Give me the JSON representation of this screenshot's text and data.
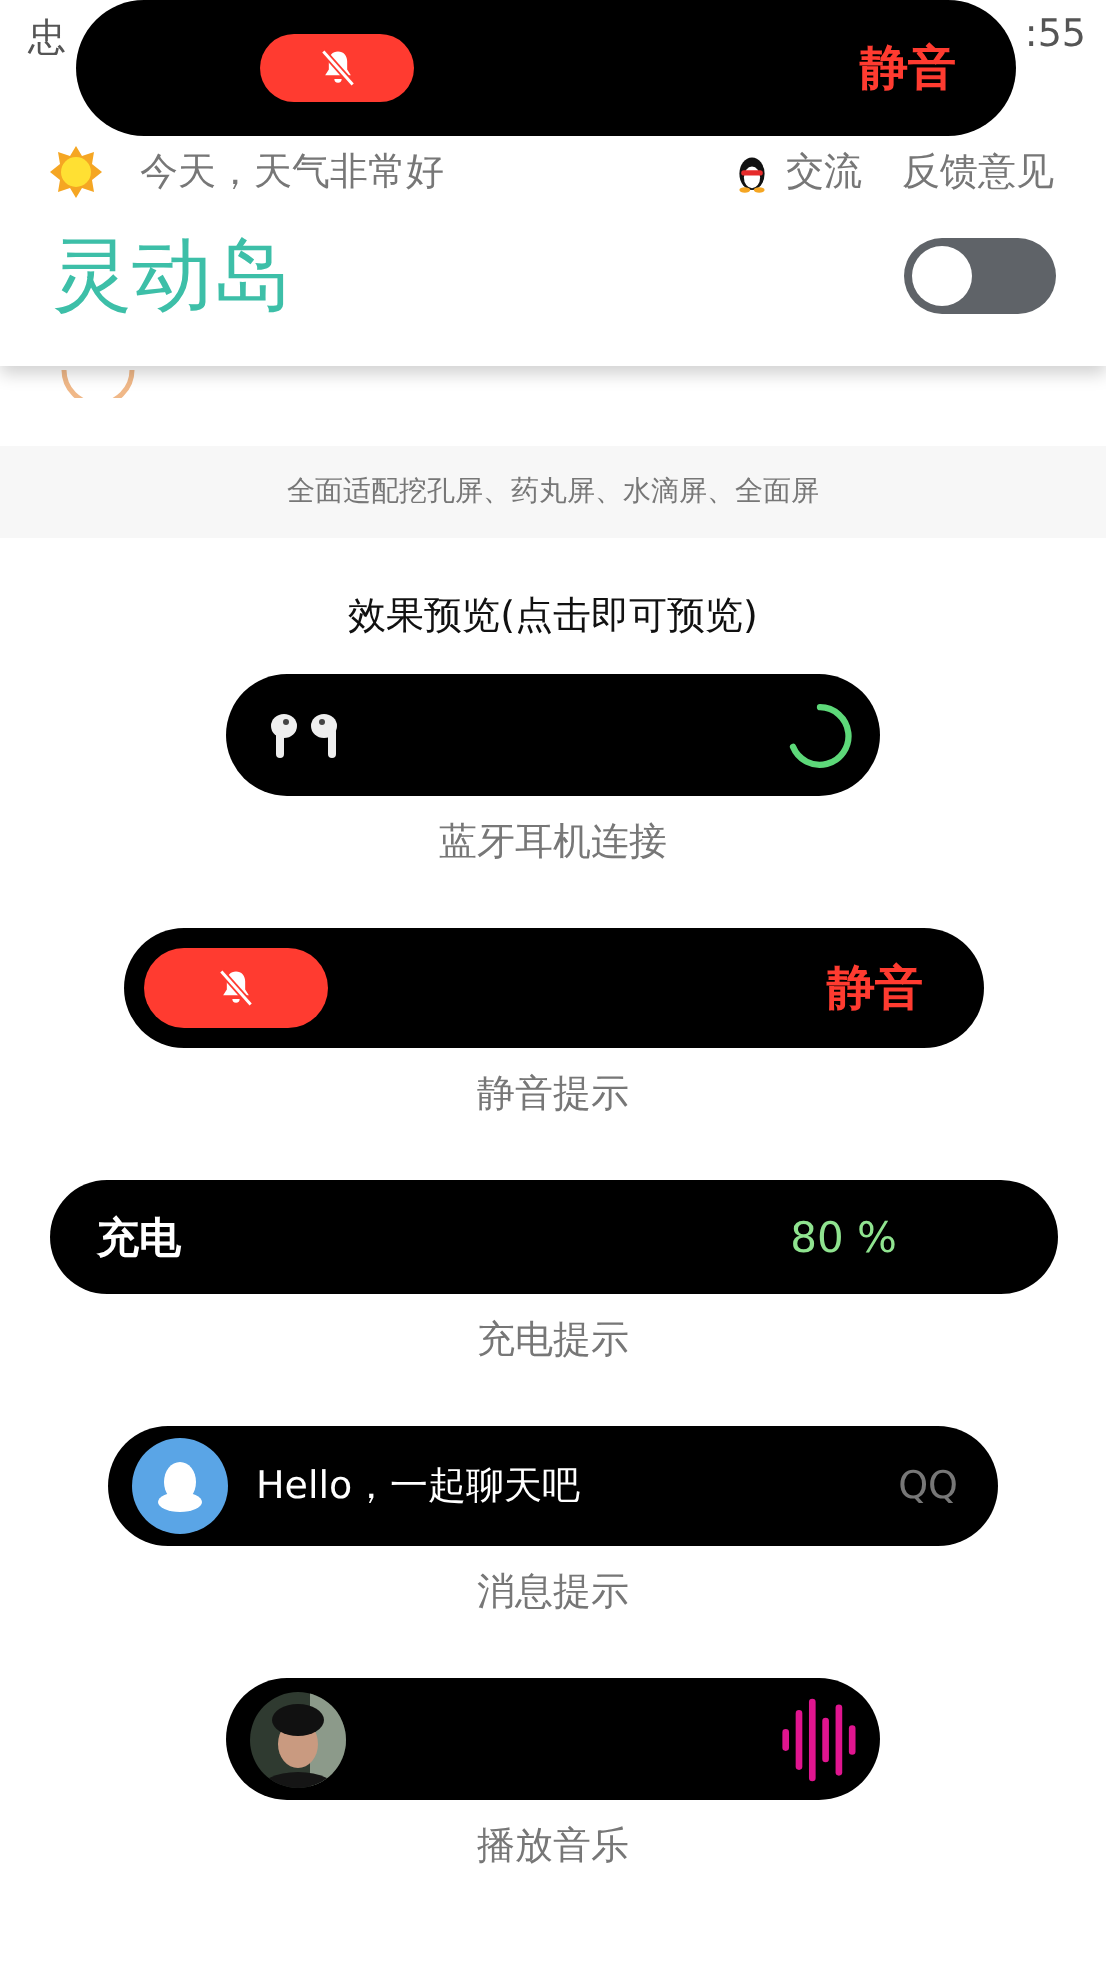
{
  "status_bar": {
    "left": "忠",
    "right": ":55"
  },
  "island_overlay": {
    "kind": "mute",
    "text": "静音"
  },
  "weather": {
    "text": "今天，天气非常好"
  },
  "links": [
    {
      "kind": "qq",
      "label": "交流"
    },
    {
      "kind": "plain",
      "label": "反馈意见"
    }
  ],
  "app": {
    "title": "灵动岛",
    "enabled": false
  },
  "notice": "全面适配挖孔屏、药丸屏、水滴屏、全面屏",
  "preview": {
    "heading": "效果预览(点击即可预览)",
    "items": [
      {
        "kind": "bluetooth",
        "label": "蓝牙耳机连接"
      },
      {
        "kind": "mute",
        "text": "静音",
        "label": "静音提示"
      },
      {
        "kind": "charging",
        "title": "充电",
        "reading": "80 %",
        "label": "充电提示"
      },
      {
        "kind": "message",
        "text": "Hello，一起聊天吧",
        "app": "QQ",
        "label": "消息提示"
      },
      {
        "kind": "music",
        "label": "播放音乐"
      }
    ]
  }
}
